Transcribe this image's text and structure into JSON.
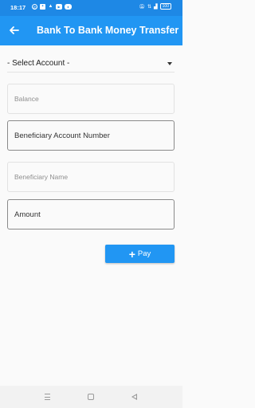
{
  "status_bar": {
    "time": "18:17",
    "battery": "100",
    "left_icons": [
      "whatsapp-icon",
      "message-icon",
      "warning-icon",
      "youtube-icon",
      "chat-icon"
    ],
    "right_icons": [
      "mute-icon",
      "network-icon",
      "signal-icon",
      "battery-icon"
    ]
  },
  "app_bar": {
    "title": "Bank To Bank Money Transfer",
    "back_icon": "arrow-left-icon",
    "color": "#2196f3"
  },
  "form": {
    "account_select": {
      "selected": "- Select Account -"
    },
    "balance": {
      "placeholder": "Balance"
    },
    "beneficiary_account": {
      "label": "Beneficiary Account Number"
    },
    "beneficiary_name": {
      "placeholder": "Beneficiary Name"
    },
    "amount": {
      "label": "Amount"
    },
    "pay_button": {
      "label": "Pay",
      "icon": "plus-icon"
    }
  },
  "nav_bar": {
    "buttons": [
      "recents-icon",
      "home-icon",
      "back-icon"
    ]
  }
}
